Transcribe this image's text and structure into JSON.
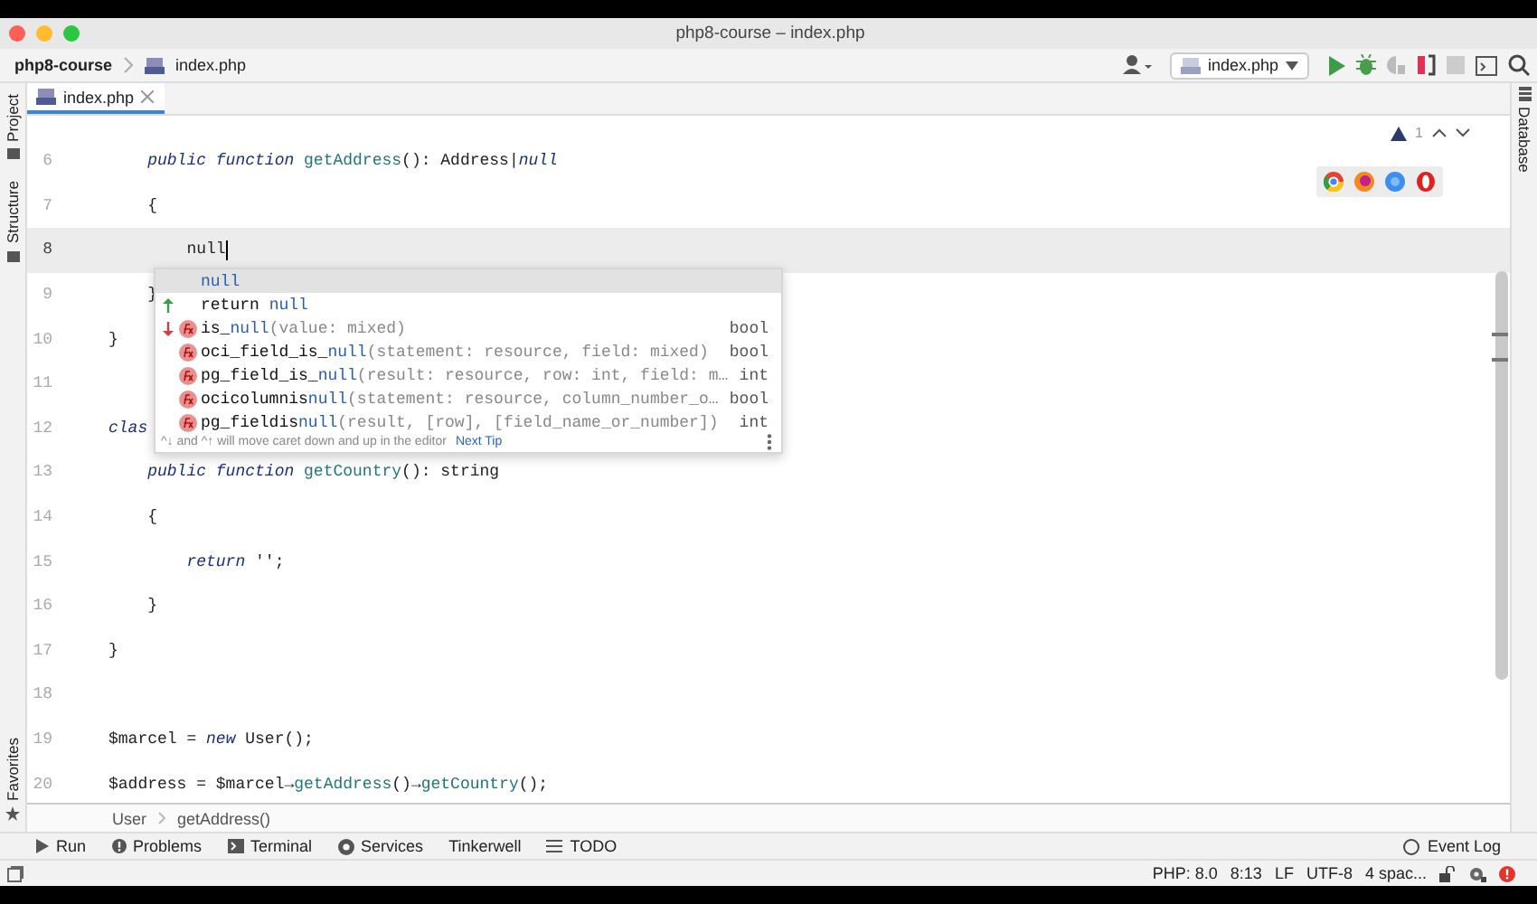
{
  "window": {
    "title": "php8-course – index.php"
  },
  "navbar": {
    "project": "php8-course",
    "file": "index.php",
    "run_config": "index.php"
  },
  "tabs": [
    {
      "label": "index.php",
      "selected": true
    }
  ],
  "left_strip": {
    "top": [
      "Project",
      "Structure"
    ],
    "bottom": [
      "Favorites"
    ]
  },
  "right_strip": [
    "Database"
  ],
  "inspection": {
    "count": "1"
  },
  "lines": [
    {
      "number": "6",
      "current": false,
      "tokens": [
        {
          "kind": "kw",
          "text": "    public function "
        },
        {
          "kind": "fn",
          "text": "getAddress"
        },
        {
          "kind": "plain",
          "text": "(): Address|"
        },
        {
          "kind": "kw",
          "text": "null"
        }
      ]
    },
    {
      "number": "7",
      "current": false,
      "tokens": [
        {
          "kind": "plain",
          "text": "    {"
        }
      ]
    },
    {
      "number": "8",
      "current": true,
      "tokens": [
        {
          "kind": "plain",
          "text": "        null"
        }
      ]
    },
    {
      "number": "9",
      "current": false,
      "tokens": [
        {
          "kind": "plain",
          "text": "    }"
        }
      ]
    },
    {
      "number": "10",
      "current": false,
      "tokens": [
        {
          "kind": "plain",
          "text": "}"
        }
      ]
    },
    {
      "number": "11",
      "current": false
    },
    {
      "number": "12",
      "current": false,
      "tokens": [
        {
          "kind": "kw",
          "text": "clas"
        }
      ]
    },
    {
      "number": "13",
      "current": false,
      "tokens": [
        {
          "kind": "kw",
          "text": "    public function "
        },
        {
          "kind": "fn",
          "text": "getCountry"
        },
        {
          "kind": "plain",
          "text": "(): string"
        }
      ]
    },
    {
      "number": "14",
      "current": false,
      "tokens": [
        {
          "kind": "plain",
          "text": "    {"
        }
      ]
    },
    {
      "number": "15",
      "current": false,
      "tokens": [
        {
          "kind": "kw",
          "text": "        return"
        },
        {
          "kind": "plain",
          "text": " '';"
        }
      ]
    },
    {
      "number": "16",
      "current": false,
      "tokens": [
        {
          "kind": "plain",
          "text": "    }"
        }
      ]
    },
    {
      "number": "17",
      "current": false,
      "tokens": [
        {
          "kind": "plain",
          "text": "}"
        }
      ]
    },
    {
      "number": "18",
      "current": false
    },
    {
      "number": "19",
      "current": false,
      "tokens": [
        {
          "kind": "plain",
          "text": "$marcel = "
        },
        {
          "kind": "kw",
          "text": "new"
        },
        {
          "kind": "plain",
          "text": " User();"
        }
      ]
    },
    {
      "number": "20",
      "current": false,
      "tokens": [
        {
          "kind": "plain",
          "text": "$address = $marcel→"
        },
        {
          "kind": "fn",
          "text": "getAddress"
        },
        {
          "kind": "plain",
          "text": "()→"
        },
        {
          "kind": "fn",
          "text": "getCountry"
        },
        {
          "kind": "plain",
          "text": "();"
        }
      ]
    }
  ],
  "completion": {
    "items": [
      {
        "kind": "keyword",
        "selected": true,
        "raised": false,
        "lowered": false,
        "match": "null"
      },
      {
        "kind": "keyword",
        "selected": false,
        "raised": true,
        "lowered": false,
        "prefix": "return ",
        "match": "null"
      },
      {
        "kind": "function",
        "selected": false,
        "raised": false,
        "lowered": true,
        "prefix": "is_",
        "match": "null",
        "rest": "(value: mixed)",
        "type": "bool"
      },
      {
        "kind": "function",
        "selected": false,
        "raised": false,
        "lowered": false,
        "prefix": "oci_field_is_",
        "match": "null",
        "rest": "(statement: resource, field: mixed)",
        "type": "bool"
      },
      {
        "kind": "function",
        "selected": false,
        "raised": false,
        "lowered": false,
        "prefix": "pg_field_is_",
        "match": "null",
        "rest": "(result: resource, row: int, field: m…",
        "type": "int"
      },
      {
        "kind": "function",
        "selected": false,
        "raised": false,
        "lowered": false,
        "prefix": "ocicolumnis",
        "match": "null",
        "rest": "(statement: resource, column_number_o…",
        "type": "bool"
      },
      {
        "kind": "function",
        "selected": false,
        "raised": false,
        "lowered": false,
        "prefix": "pg_fieldis",
        "match": "null",
        "rest": "(result, [row], [field_name_or_number])",
        "type": "int"
      }
    ],
    "hint": "^↓ and ^↑ will move caret down and up in the editor",
    "tip_link": "Next Tip"
  },
  "breadcrumbs": [
    "User",
    "getAddress()"
  ],
  "tool_windows": [
    {
      "kind": "run",
      "label": "Run"
    },
    {
      "kind": "problems",
      "label": "Problems"
    },
    {
      "kind": "terminal",
      "label": "Terminal"
    },
    {
      "kind": "services",
      "label": "Services"
    },
    {
      "kind": "plain",
      "label": "Tinkerwell"
    },
    {
      "kind": "todo",
      "label": "TODO"
    }
  ],
  "event_log": "Event Log",
  "status_bar": [
    "PHP: 8.0",
    "8:13",
    "LF",
    "UTF-8",
    "4 spac..."
  ]
}
